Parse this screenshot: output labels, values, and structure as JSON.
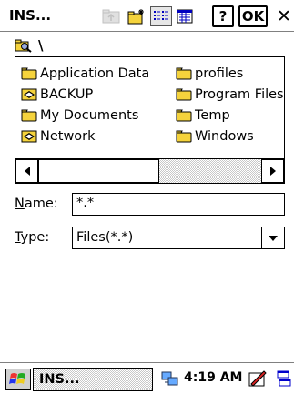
{
  "window": {
    "title": "INS..."
  },
  "toolbar": {
    "buttons": [
      {
        "name": "up-folder-button",
        "icon": "up-folder-icon",
        "enabled": false
      },
      {
        "name": "new-folder-button",
        "icon": "new-folder-icon",
        "enabled": true
      },
      {
        "name": "list-view-button",
        "icon": "list-view-icon",
        "selected": true
      },
      {
        "name": "details-view-button",
        "icon": "details-view-icon",
        "selected": false
      }
    ],
    "help_label": "?",
    "ok_label": "OK",
    "close_label": "✕"
  },
  "path": {
    "text": "\\"
  },
  "files": {
    "column_a": [
      {
        "label": "Application Data",
        "icon": "folder-icon"
      },
      {
        "label": "BACKUP",
        "icon": "shared-folder-icon"
      },
      {
        "label": "My Documents",
        "icon": "folder-icon"
      },
      {
        "label": "Network",
        "icon": "shared-folder-icon"
      }
    ],
    "column_b": [
      {
        "label": "profiles",
        "icon": "folder-icon"
      },
      {
        "label": "Program Files",
        "icon": "folder-icon"
      },
      {
        "label": "Temp",
        "icon": "folder-icon"
      },
      {
        "label": "Windows",
        "icon": "folder-icon"
      }
    ]
  },
  "form": {
    "name_label_underline": "N",
    "name_label_rest": "ame:",
    "name_value": "*.*",
    "type_label_underline": "T",
    "type_label_rest": "ype:",
    "type_value": "Files(*.*)"
  },
  "taskbar": {
    "task_label": "INS...",
    "clock": "4:19 AM"
  },
  "colors": {
    "folder_yellow": "#f5d33c",
    "selection_blue": "#0000c0"
  }
}
